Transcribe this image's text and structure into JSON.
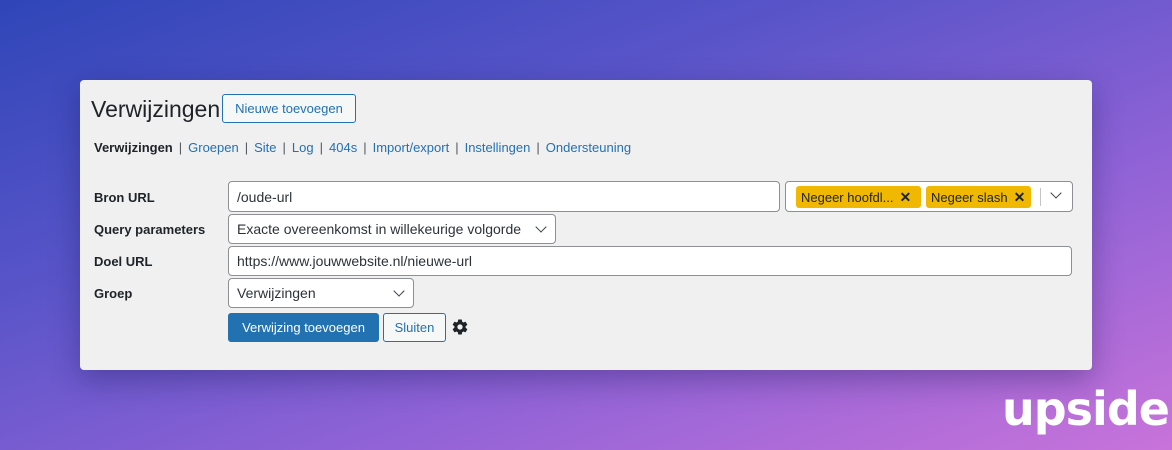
{
  "header": {
    "title": "Verwijzingen",
    "add_new_label": "Nieuwe toevoegen"
  },
  "tabs": [
    {
      "label": "Verwijzingen",
      "current": true
    },
    {
      "label": "Groepen"
    },
    {
      "label": "Site"
    },
    {
      "label": "Log"
    },
    {
      "label": "404s"
    },
    {
      "label": "Import/export"
    },
    {
      "label": "Instellingen"
    },
    {
      "label": "Ondersteuning"
    }
  ],
  "tab_separator": "|",
  "form": {
    "source_url": {
      "label": "Bron URL",
      "value": "/oude-url"
    },
    "source_options": {
      "tags": [
        {
          "label": "Negeer hoofdl..."
        },
        {
          "label": "Negeer slash"
        }
      ],
      "remove_glyph": "✕"
    },
    "query": {
      "label": "Query parameters",
      "selected": "Exacte overeenkomst in willekeurige volgorde"
    },
    "target_url": {
      "label": "Doel URL",
      "value": "https://www.jouwwebsite.nl/nieuwe-url"
    },
    "group": {
      "label": "Groep",
      "selected": "Verwijzingen"
    },
    "submit_label": "Verwijzing toevoegen",
    "close_label": "Sluiten"
  },
  "brand": {
    "logo_text": "upside"
  },
  "colors": {
    "accent": "#2271b1",
    "tag": "#f0b800",
    "panel": "#f0f0f1"
  },
  "icons": {
    "settings": "gear-icon",
    "dropdown": "chevron-down-icon",
    "remove_tag": "close-icon"
  }
}
